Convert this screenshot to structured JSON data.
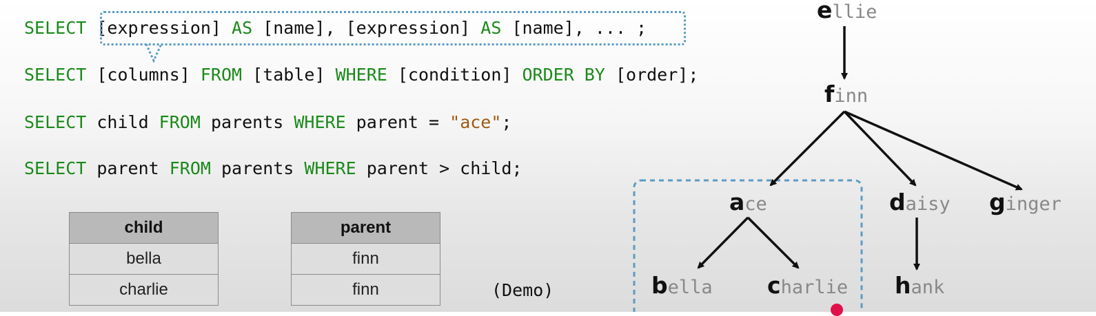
{
  "code_lines": [
    {
      "parts": [
        {
          "t": "SELECT ",
          "k": "kw"
        },
        {
          "t": "[expression] ",
          "k": ""
        },
        {
          "t": "AS",
          "k": "kw"
        },
        {
          "t": " [name], [expression] ",
          "k": ""
        },
        {
          "t": "AS",
          "k": "kw"
        },
        {
          "t": " [name], ... ;",
          "k": ""
        }
      ]
    },
    {
      "parts": [
        {
          "t": "SELECT ",
          "k": "kw"
        },
        {
          "t": "[columns] ",
          "k": ""
        },
        {
          "t": "FROM",
          "k": "kw"
        },
        {
          "t": " [table] ",
          "k": ""
        },
        {
          "t": "WHERE",
          "k": "kw"
        },
        {
          "t": " [condition] ",
          "k": ""
        },
        {
          "t": "ORDER BY",
          "k": "kw"
        },
        {
          "t": " [order];",
          "k": ""
        }
      ]
    },
    {
      "parts": [
        {
          "t": "SELECT ",
          "k": "kw"
        },
        {
          "t": "child ",
          "k": ""
        },
        {
          "t": "FROM",
          "k": "kw"
        },
        {
          "t": " parents ",
          "k": ""
        },
        {
          "t": "WHERE",
          "k": "kw"
        },
        {
          "t": " parent = ",
          "k": ""
        },
        {
          "t": "\"ace\"",
          "k": "str"
        },
        {
          "t": ";",
          "k": ""
        }
      ]
    },
    {
      "parts": [
        {
          "t": "SELECT ",
          "k": "kw"
        },
        {
          "t": "parent ",
          "k": ""
        },
        {
          "t": "FROM",
          "k": "kw"
        },
        {
          "t": " parents ",
          "k": ""
        },
        {
          "t": "WHERE",
          "k": "kw"
        },
        {
          "t": " parent > child;",
          "k": ""
        }
      ]
    }
  ],
  "table_child": {
    "header": "child",
    "rows": [
      "bella",
      "charlie"
    ]
  },
  "table_parent": {
    "header": "parent",
    "rows": [
      "finn",
      "finn"
    ]
  },
  "demo_label": "(Demo)",
  "tree": {
    "nodes": [
      {
        "id": "ellie",
        "init": "e",
        "rest": "llie"
      },
      {
        "id": "finn",
        "init": "f",
        "rest": "inn"
      },
      {
        "id": "ace",
        "init": "a",
        "rest": "ce"
      },
      {
        "id": "daisy",
        "init": "d",
        "rest": "aisy"
      },
      {
        "id": "ginger",
        "init": "g",
        "rest": "inger"
      },
      {
        "id": "bella",
        "init": "b",
        "rest": "ella"
      },
      {
        "id": "charlie",
        "init": "c",
        "rest": "harlie"
      },
      {
        "id": "hank",
        "init": "h",
        "rest": "ank"
      }
    ],
    "edges": [
      [
        "ellie",
        "finn"
      ],
      [
        "finn",
        "ace"
      ],
      [
        "finn",
        "daisy"
      ],
      [
        "finn",
        "ginger"
      ],
      [
        "ace",
        "bella"
      ],
      [
        "ace",
        "charlie"
      ],
      [
        "daisy",
        "hank"
      ]
    ]
  },
  "colors": {
    "keyword": "#1a8a1a",
    "string": "#a05a10",
    "highlight": "#5b9bc4",
    "cursor": "#e0104a"
  }
}
